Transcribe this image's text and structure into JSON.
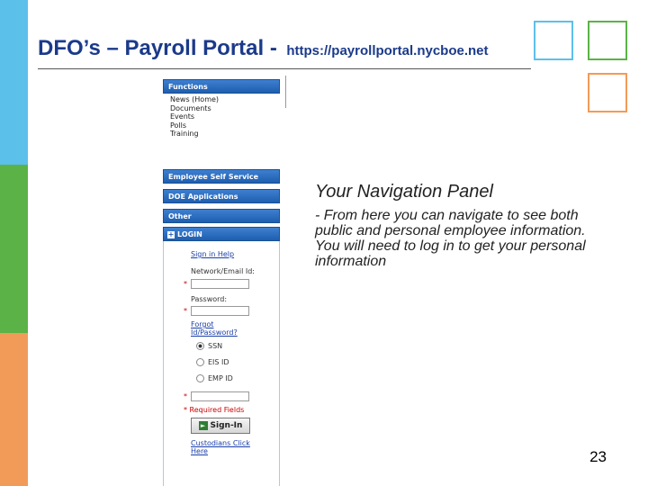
{
  "slide": {
    "title": "DFO’s – Payroll Portal -",
    "url": "https://payrollportal.nycboe.net",
    "page_number": "23"
  },
  "nav_panel": {
    "functions_header": "Functions",
    "functions_items": [
      "News (Home)",
      "Documents",
      "Events",
      "Polls",
      "Training"
    ],
    "employee_self_service": "Employee Self Service",
    "doe_applications": "DOE Applications",
    "other": "Other",
    "login_header": "LOGIN",
    "signin_help": "Sign in Help",
    "network_email_label": "Network/Email Id:",
    "password_label": "Password:",
    "forgot_link": "Forgot Id/Password?",
    "radio_options": [
      "SSN",
      "EIS ID",
      "EMP ID"
    ],
    "required_asterisk": "*",
    "required_fields_note": "* Required Fields",
    "signin_button": "Sign-In",
    "custodians_link": "Custodians Click Here"
  },
  "description": {
    "heading": "Your Navigation Panel",
    "body": "- From here you can navigate to see both public and personal employee information. You will need to log in to get your personal information"
  },
  "colors": {
    "bar_blue": "#5bc0ea",
    "bar_green": "#5bb347",
    "bar_orange": "#f29b58",
    "title_color": "#1b3a8a",
    "nav_header_blue": "#1f5eaf"
  }
}
